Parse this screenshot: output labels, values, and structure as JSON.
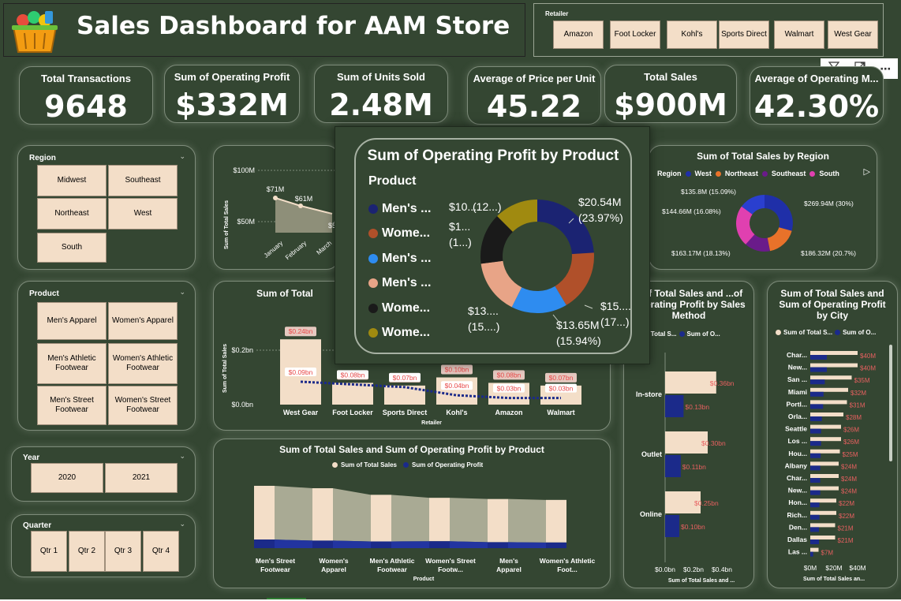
{
  "header": {
    "title": "Sales Dashboard for AAM Store"
  },
  "retailer": {
    "label": "Retailer",
    "options": [
      "Amazon",
      "Foot Locker",
      "Kohl's",
      "Sports Direct",
      "Walmart",
      "West Gear"
    ]
  },
  "kpis": [
    {
      "label": "Total Transactions",
      "value": "9648"
    },
    {
      "label": "Sum of Operating Profit",
      "value": "$332M"
    },
    {
      "label": "Sum of Units Sold",
      "value": "2.48M"
    },
    {
      "label": "Average of Price per Unit",
      "value": "45.22"
    },
    {
      "label": "Total Sales",
      "value": "$900M"
    },
    {
      "label": "Average of Operating M...",
      "value": "42.30%"
    }
  ],
  "region_slicer": {
    "label": "Region",
    "options": [
      "Midwest",
      "Southeast",
      "Northeast",
      "West",
      "South"
    ]
  },
  "product_slicer": {
    "label": "Product",
    "options": [
      "Men's Apparel",
      "Women's Apparel",
      "Men's Athletic Footwear",
      "Women's Athletic Footwear",
      "Men's Street Footwear",
      "Women's Street Footwear"
    ]
  },
  "year_slicer": {
    "label": "Year",
    "options": [
      "2020",
      "2021"
    ]
  },
  "quarter_slicer": {
    "label": "Quarter",
    "options": [
      "Qtr 1",
      "Qtr 2",
      "Qtr 3",
      "Qtr 4"
    ]
  },
  "monthly": {
    "ylabel": "Sum of Total Sales",
    "yticks": [
      "$100M",
      "$50M"
    ],
    "months": [
      "January",
      "February",
      "March"
    ],
    "labels": [
      "$71M",
      "$61M",
      "$5"
    ]
  },
  "popup": {
    "title": "Sum of Operating Profit by Product",
    "legend_title": "Product",
    "legend": [
      "Men's ...",
      "Wome...",
      "Men's ...",
      "Men's ...",
      "Wome...",
      "Wome..."
    ],
    "labels": [
      "$20.54M",
      "(23.97%)",
      "$15....",
      "(17...)",
      "$13.65M",
      "(15.94%)",
      "$13....",
      "(15....)",
      "$1...",
      "(1...)",
      "$10....",
      "(12...)"
    ]
  },
  "region_donut": {
    "title": "Sum of Total Sales by Region",
    "legend_title": "Region",
    "legend": [
      "West",
      "Northeast",
      "Southeast",
      "South"
    ],
    "labels": [
      "$269.94M (30%)",
      "$186.32M (20.7%)",
      "$163.17M (18.13%)",
      "$144.66M (16.08%)",
      "$135.8M (15.09%)"
    ]
  },
  "retailer_chart": {
    "title": "Sum of Total",
    "ylabel": "Sum of Total Sales",
    "xlabel": "Retailer",
    "yticks": [
      "$0.2bn",
      "$0.0bn"
    ],
    "categories": [
      "West Gear",
      "Foot Locker",
      "Sports Direct",
      "Kohl's",
      "Amazon",
      "Walmart"
    ],
    "sales_labels": [
      "$0.24bn",
      "$0.08bn",
      "$0.07bn",
      "$0.10bn",
      "$0.08bn",
      "$0.07bn"
    ],
    "profit_labels": [
      "$0.09bn",
      "$0.08bn",
      "$0.07bn",
      "$0.04bn",
      "$0.03bn",
      "$0.03bn"
    ]
  },
  "product_ribbon": {
    "title": "Sum of Total Sales and Sum of Operating Profit by Product",
    "legend": [
      "Sum of Total Sales",
      "Sum of Operating Profit"
    ],
    "xlabel": "Product",
    "categories": [
      "Men's Street Footwear",
      "Women's Apparel",
      "Men's Athletic Footwear",
      "Women's Street Footw...",
      "Men's Apparel",
      "Women's Athletic Foot..."
    ]
  },
  "method_chart": {
    "title": "...of Total Sales and ...of Operating Profit by Sales Method",
    "legend": [
      "...m of Total S...",
      "Sum of O..."
    ],
    "categories": [
      "In-store",
      "Outlet",
      "Online"
    ],
    "sales_labels": [
      "$0.36bn",
      "$0.30bn",
      "$0.25bn"
    ],
    "profit_labels": [
      "$0.13bn",
      "$0.11bn",
      "$0.10bn"
    ],
    "xticks": [
      "$0.0bn",
      "$0.2bn",
      "$0.4bn"
    ],
    "xlabel": "Sum of Total Sales and ..."
  },
  "city_chart": {
    "title": "Sum of Total Sales and Sum of Operating Profit by City",
    "legend": [
      "Sum of Total S...",
      "Sum of O..."
    ],
    "cities": [
      "Char...",
      "New...",
      "San ...",
      "Miami",
      "Portl...",
      "Orla...",
      "Seattle",
      "Los ...",
      "Hou...",
      "Albany",
      "Char...",
      "New...",
      "Hon...",
      "Rich...",
      "Den...",
      "Dallas",
      "Las ..."
    ],
    "labels": [
      "$40M",
      "$40M",
      "$35M",
      "$32M",
      "$31M",
      "$28M",
      "$26M",
      "$26M",
      "$25M",
      "$24M",
      "$24M",
      "$24M",
      "$22M",
      "$22M",
      "$21M",
      "$21M",
      "$7M"
    ],
    "xticks": [
      "$0M",
      "$20M",
      "$40M"
    ],
    "xlabel": "Sum of Total Sales an..."
  },
  "colors": {
    "bg": "#344632",
    "cream": "#f3dec8",
    "navy": "#1b2a8a",
    "accent_red": "#ff6b6b"
  }
}
